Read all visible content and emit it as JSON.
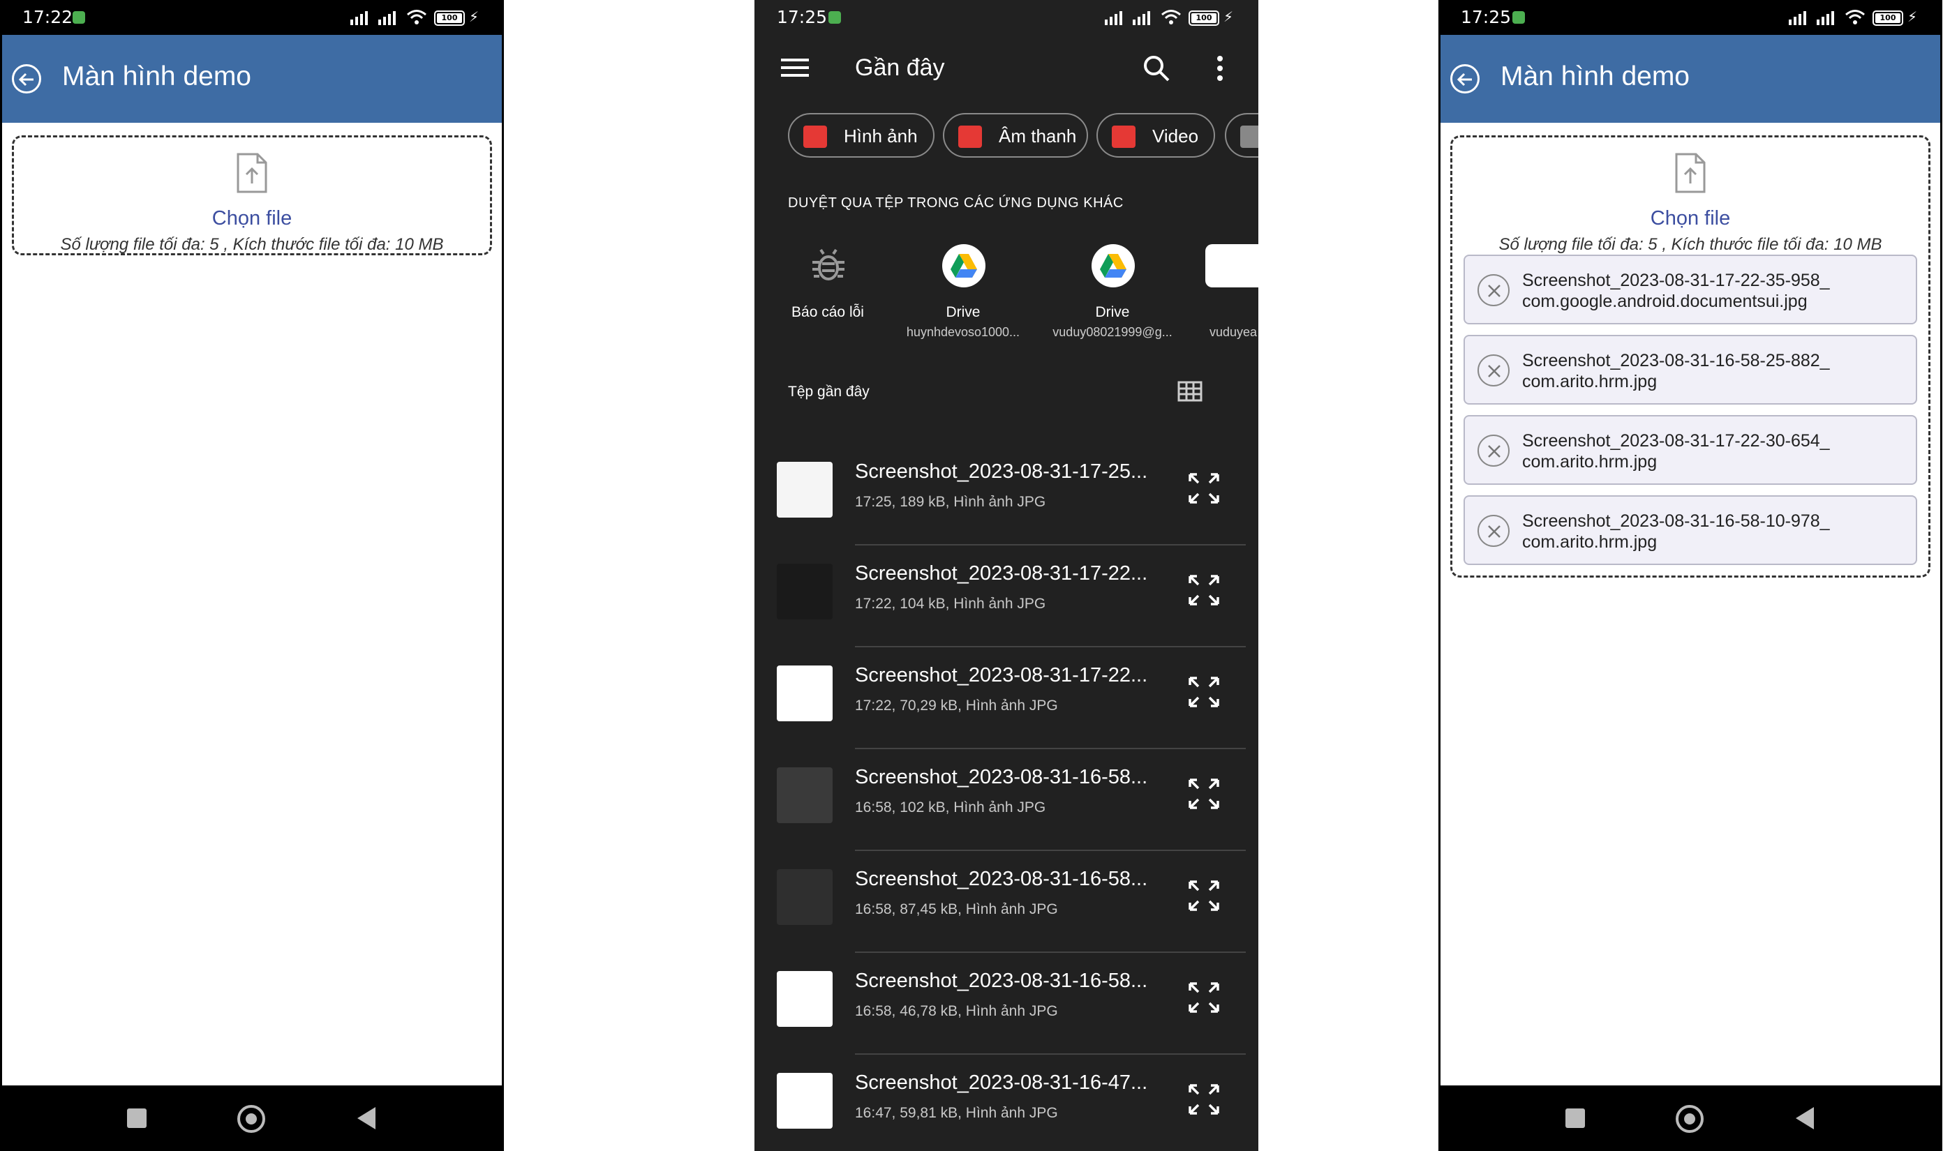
{
  "left_screen": {
    "status_time": "17:22",
    "battery": "100",
    "title": "Màn hình demo",
    "choose_file": "Chọn file",
    "hint": "Số lượng file tối đa: 5 , Kích thước file tối đa: 10 MB"
  },
  "picker": {
    "status_time": "17:25",
    "battery": "100",
    "title": "Gần đây",
    "chips": [
      {
        "label": "Hình ảnh"
      },
      {
        "label": "Âm thanh"
      },
      {
        "label": "Video"
      }
    ],
    "section_label": "DUYỆT QUA TỆP TRONG CÁC ỨNG DỤNG KHÁC",
    "apps": [
      {
        "name": "Báo cáo lỗi",
        "sub": ""
      },
      {
        "name": "Drive",
        "sub": "huynhdevoso1000..."
      },
      {
        "name": "Drive",
        "sub": "vuduy08021999@g..."
      },
      {
        "name": "",
        "sub": "vuduyea"
      }
    ],
    "recent_label": "Tệp gần đây",
    "files": [
      {
        "name": "Screenshot_2023-08-31-17-25...",
        "meta": "17:25, 189 kB, Hình ảnh JPG",
        "thumb": "#f5f5f5"
      },
      {
        "name": "Screenshot_2023-08-31-17-22...",
        "meta": "17:22, 104 kB, Hình ảnh JPG",
        "thumb": "#1a1a1a"
      },
      {
        "name": "Screenshot_2023-08-31-17-22...",
        "meta": "17:22, 70,29 kB, Hình ảnh JPG",
        "thumb": "#ffffff"
      },
      {
        "name": "Screenshot_2023-08-31-16-58...",
        "meta": "16:58, 102 kB, Hình ảnh JPG",
        "thumb": "#3a3a3a"
      },
      {
        "name": "Screenshot_2023-08-31-16-58...",
        "meta": "16:58, 87,45 kB, Hình ảnh JPG",
        "thumb": "#2f2f2f"
      },
      {
        "name": "Screenshot_2023-08-31-16-58...",
        "meta": "16:58, 46,78 kB, Hình ảnh JPG",
        "thumb": "#ffffff"
      },
      {
        "name": "Screenshot_2023-08-31-16-47...",
        "meta": "16:47, 59,81 kB, Hình ảnh JPG",
        "thumb": "#ffffff"
      }
    ]
  },
  "right_screen": {
    "status_time": "17:25",
    "battery": "100",
    "title": "Màn hình demo",
    "choose_file": "Chọn file",
    "hint": "Số lượng file tối đa: 5 , Kích thước file tối đa: 10 MB",
    "files": [
      "Screenshot_2023-08-31-17-22-35-958_\ncom.google.android.documentsui.jpg",
      "Screenshot_2023-08-31-16-58-25-882_\ncom.arito.hrm.jpg",
      "Screenshot_2023-08-31-17-22-30-654_\ncom.arito.hrm.jpg",
      "Screenshot_2023-08-31-16-58-10-978_\ncom.arito.hrm.jpg"
    ]
  },
  "colors": {
    "appbar": "#3e6ca4",
    "link": "#3c4ea0",
    "picker_bg": "#212121",
    "chip_icon": "#e53935"
  }
}
